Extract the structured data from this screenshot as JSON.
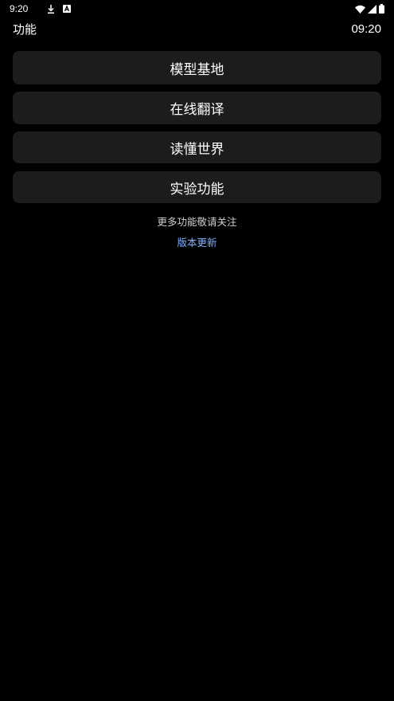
{
  "status_bar": {
    "clock": "9:20",
    "left_icons": [
      "download-icon",
      "a-box-icon"
    ],
    "right_icons": [
      "wifi-icon",
      "signal-icon",
      "battery-icon"
    ]
  },
  "header": {
    "title": "功能",
    "time": "09:20"
  },
  "menu": {
    "items": [
      {
        "label": "模型基地"
      },
      {
        "label": "在线翻译"
      },
      {
        "label": "读懂世界"
      },
      {
        "label": "实验功能"
      }
    ]
  },
  "footer": {
    "note": "更多功能敬请关注",
    "update_link": "版本更新"
  },
  "colors": {
    "background": "#000000",
    "button": "#1c1c1c",
    "link": "#7fb0ff"
  }
}
